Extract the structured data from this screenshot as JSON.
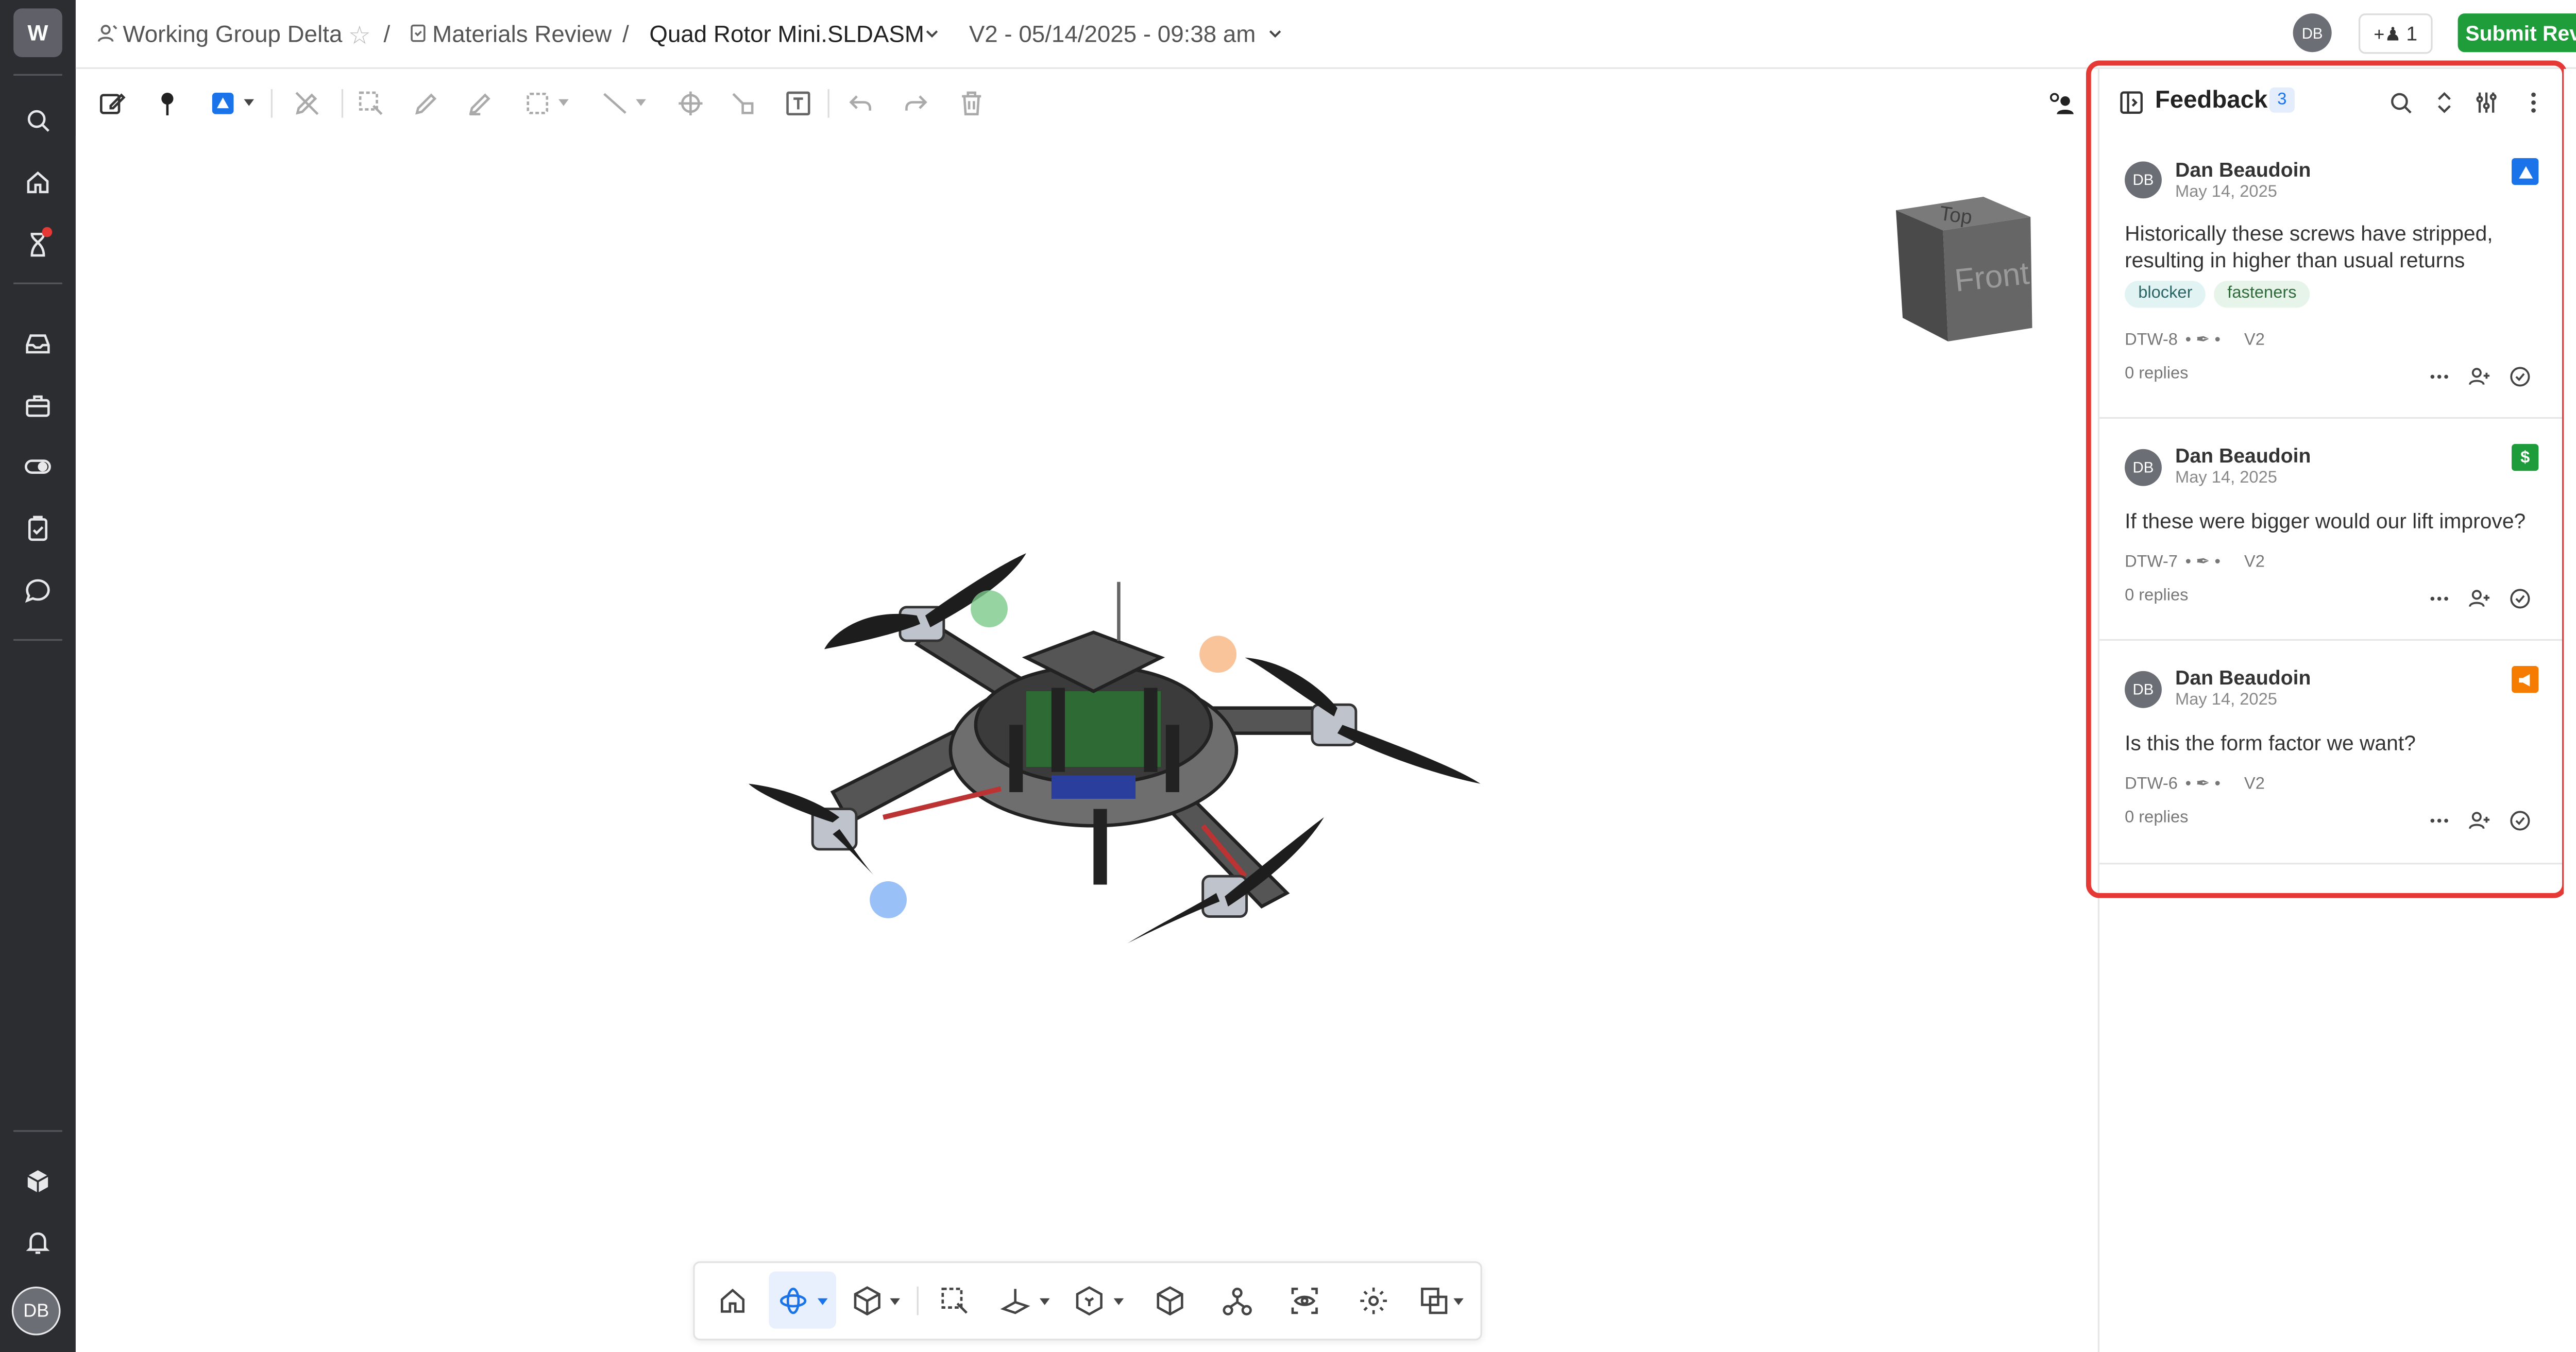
{
  "workspace": {
    "initial": "W"
  },
  "breadcrumb": {
    "group": "Working Group Delta",
    "separator": "/",
    "review": "Materials Review",
    "file": "Quad Rotor Mini.SLDASM",
    "version": "V2 - 05/14/2025 - 09:38 am"
  },
  "header": {
    "user_initials": "DB",
    "share_count": "1",
    "submit_label": "Submit Review",
    "submit_color": "#1f9d3a"
  },
  "sidebar": {
    "icons": [
      "search-icon",
      "home-icon",
      "hourglass-icon",
      "inbox-icon",
      "briefcase-icon",
      "toggle-icon",
      "clipboard-icon",
      "chat-icon",
      "package-icon",
      "bell-icon"
    ],
    "user_initials": "DB"
  },
  "viewcube": {
    "top_label": "Top",
    "front_label": "Front"
  },
  "panel": {
    "title": "Feedback",
    "count": "3",
    "highlight_color": "#e53935",
    "comments": [
      {
        "initials": "DB",
        "author": "Dan Beaudoin",
        "date": "May 14, 2025",
        "text": "Historically these screws have stripped, resulting in higher than usual returns",
        "tags": [
          "blocker",
          "fasteners"
        ],
        "id": "DTW-8",
        "version": "V2",
        "replies": "0 replies",
        "category_icon": "warning-triangle-icon",
        "category_color": "#1a73e8"
      },
      {
        "initials": "DB",
        "author": "Dan Beaudoin",
        "date": "May 14, 2025",
        "text": "If these were bigger would our lift improve?",
        "tags": [],
        "id": "DTW-7",
        "version": "V2",
        "replies": "0 replies",
        "category_icon": "dollar-icon",
        "category_color": "#1e9b3b",
        "category_glyph": "$"
      },
      {
        "initials": "DB",
        "author": "Dan Beaudoin",
        "date": "May 14, 2025",
        "text": "Is this the form factor we want?",
        "tags": [],
        "id": "DTW-6",
        "version": "V2",
        "replies": "0 replies",
        "category_icon": "megaphone-icon",
        "category_color": "#f57c00"
      }
    ]
  },
  "rail": {
    "badge": "3"
  }
}
